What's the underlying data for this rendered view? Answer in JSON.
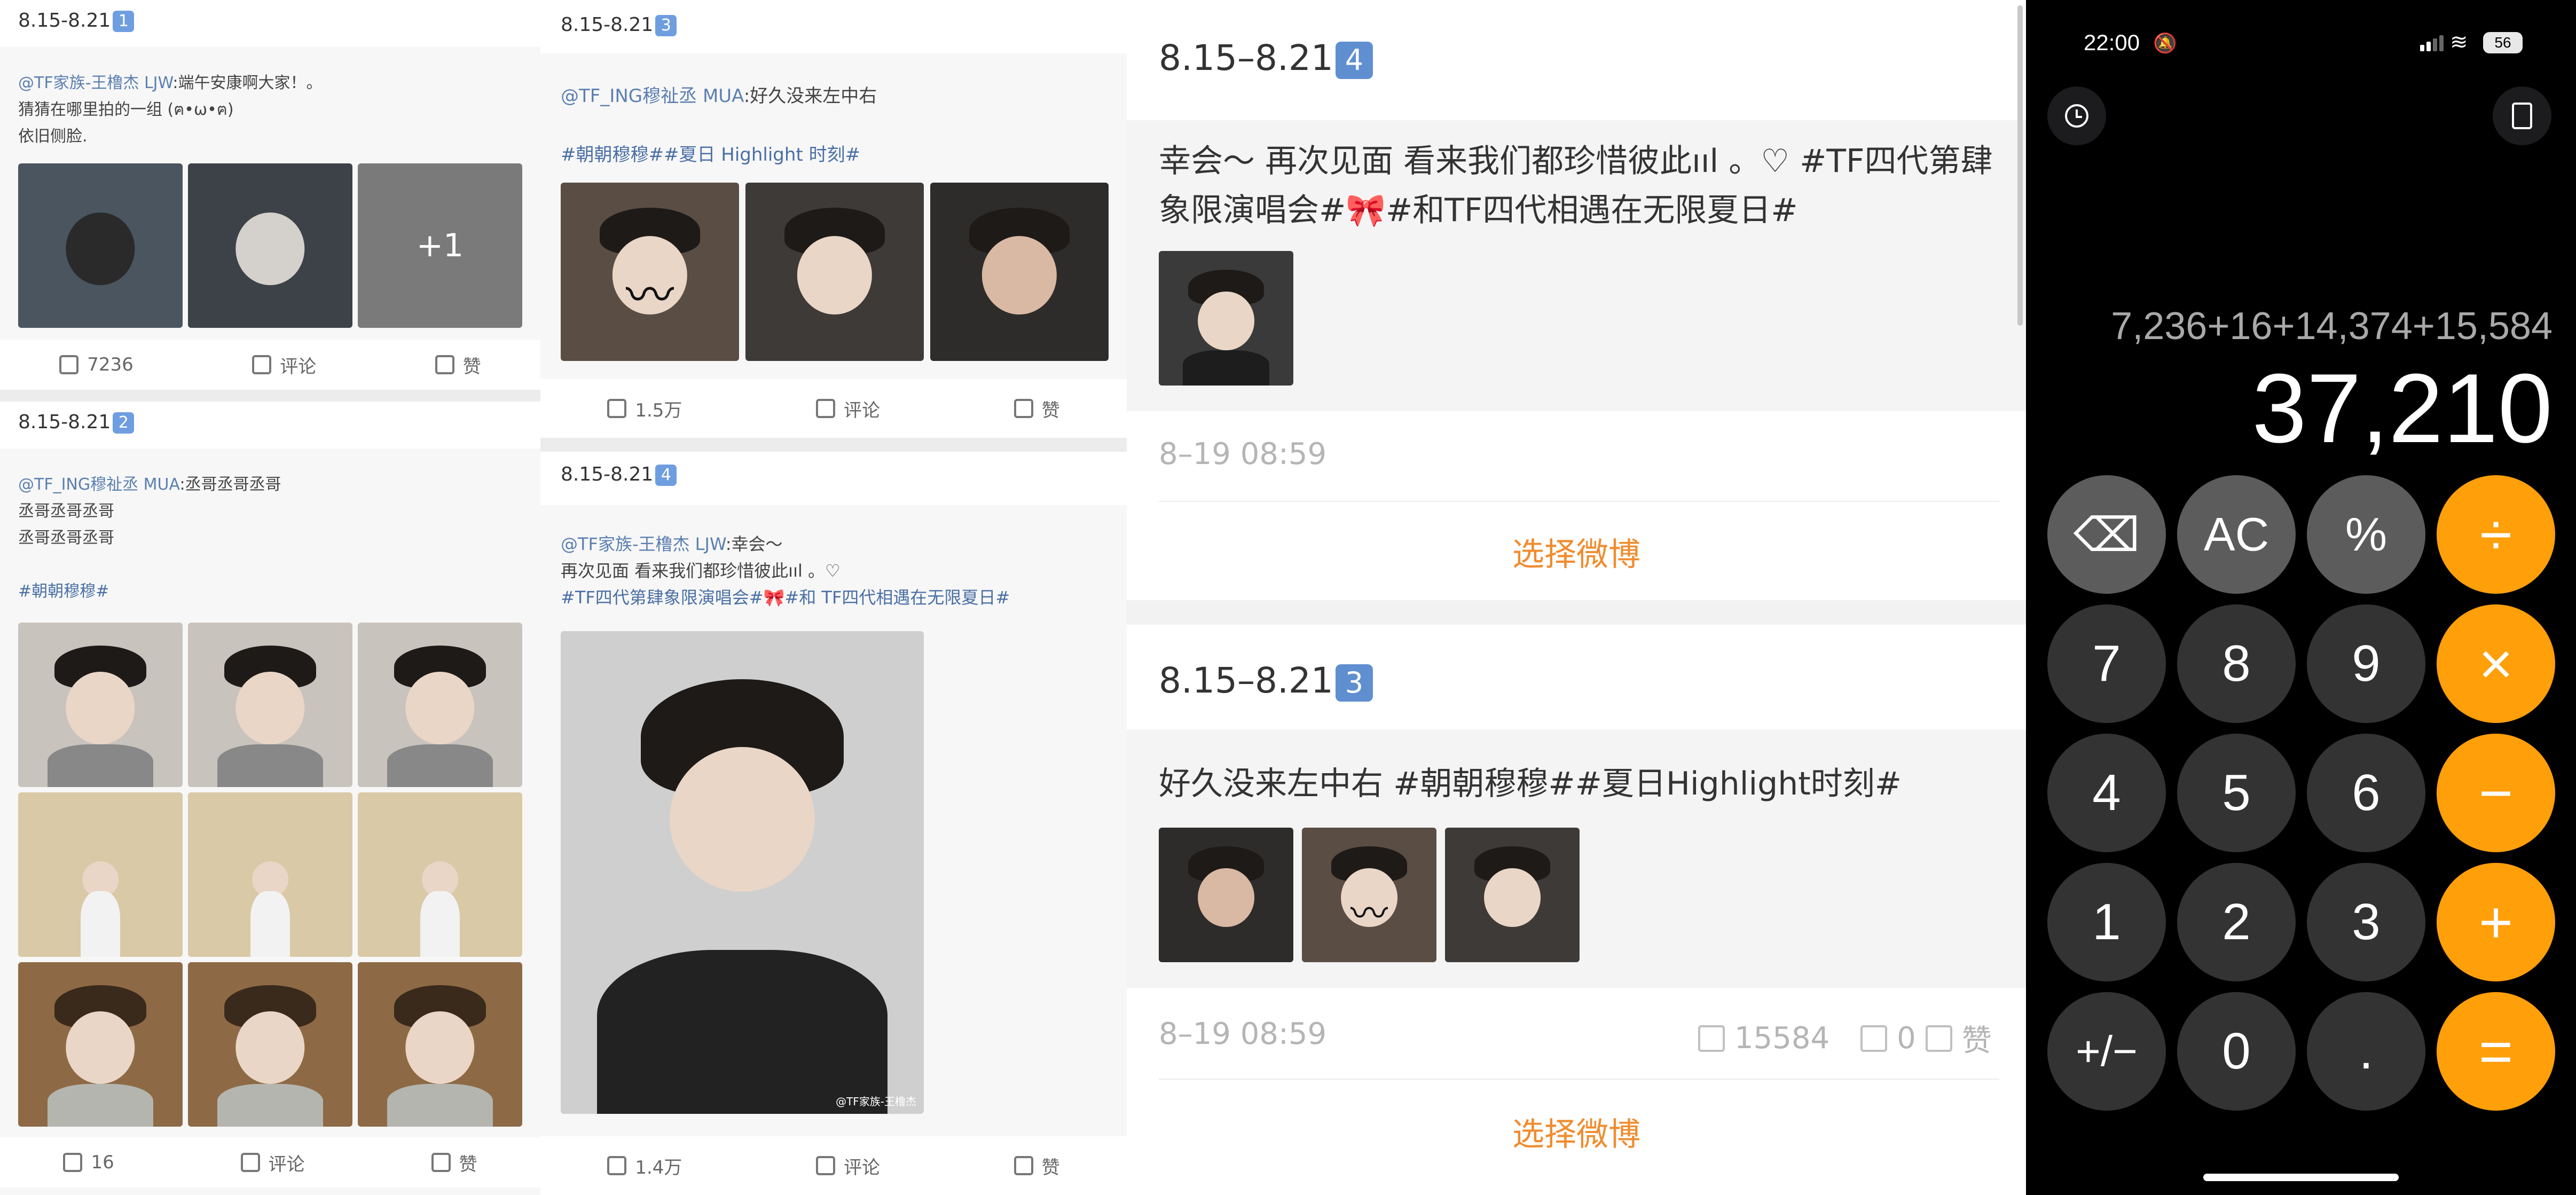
{
  "panel1": {
    "post1": {
      "date": "8.15-8.21",
      "badge": "1",
      "author": "@TF家族-王橹杰 LJW",
      "text1": ":端午安康啊大家！。",
      "text2": "猜猜在哪里拍的一组 (ฅ•ω•ฅ)",
      "text3": "依旧侧脸.",
      "more": "+1",
      "repost": "7236",
      "comment": "评论",
      "like": "赞"
    },
    "post2": {
      "date": "8.15-8.21",
      "badge": "2",
      "author": "@TF_ING穆祉丞 MUA",
      "text1": ":丞哥丞哥丞哥",
      "text2": "丞哥丞哥丞哥",
      "text3": "丞哥丞哥丞哥",
      "tag": "#朝朝穆穆#",
      "repost": "16",
      "comment": "评论",
      "like": "赞"
    }
  },
  "panel2": {
    "post1": {
      "date": "8.15-8.21",
      "badge": "3",
      "author": "@TF_ING穆祉丞 MUA",
      "text1": ":好久没来左中右",
      "tag": "#朝朝穆穆##夏日 Highlight 时刻#",
      "repost": "1.5万",
      "comment": "评论",
      "like": "赞"
    },
    "post2": {
      "date": "8.15-8.21",
      "badge": "4",
      "author": "@TF家族-王橹杰 LJW",
      "text1": ":幸会～",
      "text2": "再次见面 看来我们都珍惜彼此ııl 。♡",
      "tag": "#TF四代第肆象限演唱会#🎀#和 TF四代相遇在无限夏日#",
      "watermark": "@TF家族-王橹杰",
      "repost": "1.4万",
      "comment": "评论",
      "like": "赞"
    }
  },
  "panel3": {
    "card1": {
      "date": "8.15–8.21",
      "badge": "4",
      "text1": "幸会～ 再次见面 看来我们都珍惜彼此ııl 。♡ #TF四代第肆",
      "text2": "象限演唱会#🎀#和TF四代相遇在无限夏日#",
      "time": "8–19 08:59",
      "select": "选择微博"
    },
    "card2": {
      "date": "8.15–8.21",
      "badge": "3",
      "text1": "好久没来左中右 #朝朝穆穆##夏日Highlight时刻#",
      "time": "8–19 08:59",
      "repost": "15584",
      "comments": "0",
      "like": "赞",
      "select": "选择微博"
    }
  },
  "calculator": {
    "time": "22:00",
    "battery": "56",
    "expression": "7,236+16+14,374+15,584",
    "result": "37,210",
    "keys": {
      "back": "⌫",
      "ac": "AC",
      "pct": "%",
      "div": "÷",
      "k7": "7",
      "k8": "8",
      "k9": "9",
      "mul": "×",
      "k4": "4",
      "k5": "5",
      "k6": "6",
      "sub": "−",
      "k1": "1",
      "k2": "2",
      "k3": "3",
      "add": "+",
      "neg": "+/−",
      "k0": "0",
      "dot": ".",
      "eq": "="
    }
  },
  "colors": {
    "accent": "#f08c2f",
    "badge": "#5f8fd0",
    "op": "#ff9f0a",
    "link": "#5b7fb0"
  }
}
